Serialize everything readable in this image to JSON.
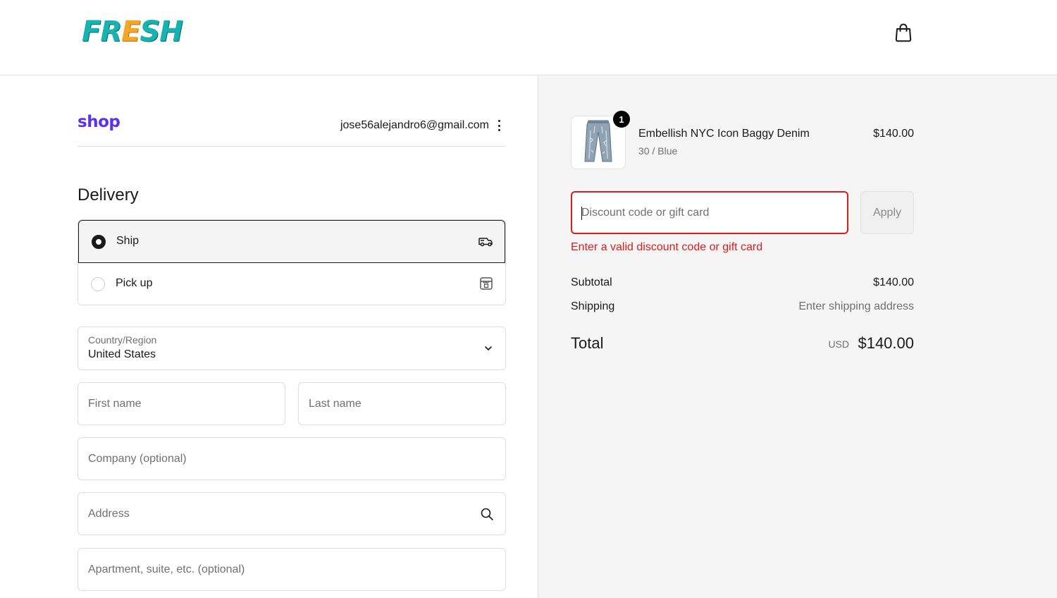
{
  "header": {
    "logo_parts": [
      "FR",
      "E",
      "SH"
    ],
    "cart_icon": "shopping-bag-icon"
  },
  "account": {
    "shop_logo": "shop",
    "email": "jose56alejandro6@gmail.com",
    "menu_icon": "kebab-menu-icon"
  },
  "delivery": {
    "title": "Delivery",
    "options": [
      {
        "label": "Ship",
        "selected": true,
        "icon": "truck-icon"
      },
      {
        "label": "Pick up",
        "selected": false,
        "icon": "store-icon"
      }
    ]
  },
  "form": {
    "country_label": "Country/Region",
    "country_value": "United States",
    "first_name_placeholder": "First name",
    "last_name_placeholder": "Last name",
    "company_placeholder": "Company (optional)",
    "address_placeholder": "Address",
    "apartment_placeholder": "Apartment, suite, etc. (optional)"
  },
  "order": {
    "item": {
      "quantity": "1",
      "name": "Embellish NYC Icon Baggy Denim",
      "variant": "30 / Blue",
      "price": "$140.00"
    },
    "discount_placeholder": "Discount code or gift card",
    "apply_label": "Apply",
    "error": "Enter a valid discount code or gift card",
    "subtotal_label": "Subtotal",
    "subtotal_value": "$140.00",
    "shipping_label": "Shipping",
    "shipping_value": "Enter shipping address",
    "total_label": "Total",
    "currency": "USD",
    "total_value": "$140.00"
  },
  "colors": {
    "shop_purple": "#5a31f4",
    "error_red": "#dd1d1d",
    "logo_teal": "#17b3b0",
    "logo_orange": "#f5a623"
  }
}
